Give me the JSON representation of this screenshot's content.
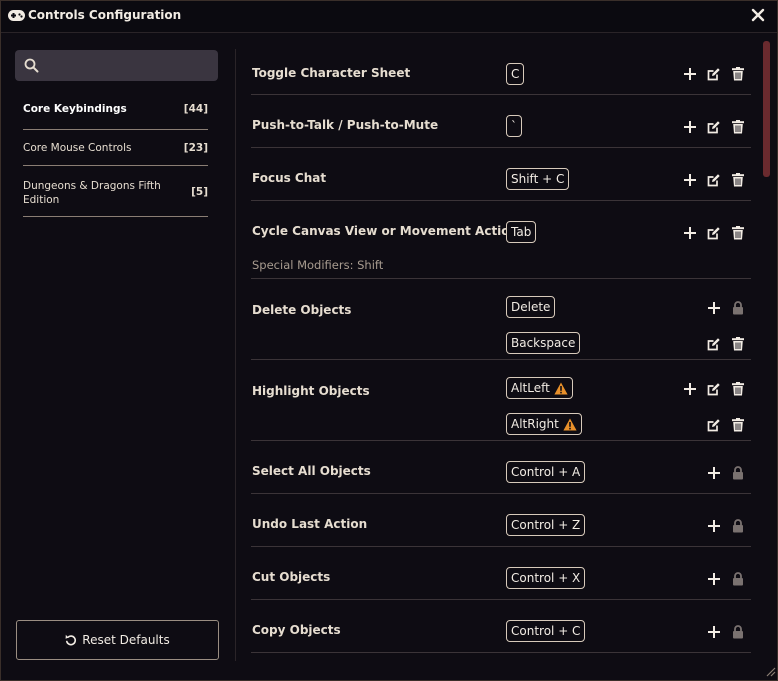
{
  "window": {
    "title": "Controls Configuration"
  },
  "search": {
    "placeholder": ""
  },
  "sidebar": {
    "categories": [
      {
        "label": "Core Keybindings",
        "count": "[44]"
      },
      {
        "label": "Core Mouse Controls",
        "count": "[23]"
      },
      {
        "label": "Dungeons & Dragons Fifth Edition",
        "count": "[5]"
      }
    ],
    "reset_label": "Reset Defaults"
  },
  "bindings": [
    {
      "label": "Toggle Character Sheet",
      "keys": [
        "C"
      ]
    },
    {
      "label": "Push-to-Talk / Push-to-Mute",
      "keys": [
        "`"
      ]
    },
    {
      "label": "Focus Chat",
      "keys": [
        "Shift + C"
      ]
    },
    {
      "label": "Cycle Canvas View or Movement Action",
      "keys": [
        "Tab"
      ],
      "modifiers": "Special Modifiers: Shift"
    },
    {
      "label": "Delete Objects",
      "keys": [
        "Delete",
        "Backspace"
      ]
    },
    {
      "label": "Highlight Objects",
      "keys": [
        "AltLeft",
        "AltRight"
      ]
    },
    {
      "label": "Select All Objects",
      "keys": [
        "Control + A"
      ]
    },
    {
      "label": "Undo Last Action",
      "keys": [
        "Control + Z"
      ]
    },
    {
      "label": "Cut Objects",
      "keys": [
        "Control + X"
      ]
    },
    {
      "label": "Copy Objects",
      "keys": [
        "Control + C"
      ]
    }
  ],
  "colors": {
    "background": "#0e0c13",
    "accent": "#6a2a2e",
    "warning": "#e8902a",
    "text": "#e6ddd0"
  },
  "icons": {
    "add": "plus-icon",
    "edit": "edit-icon",
    "delete": "trash-icon",
    "locked": "lock-icon",
    "warning": "warning-icon"
  }
}
